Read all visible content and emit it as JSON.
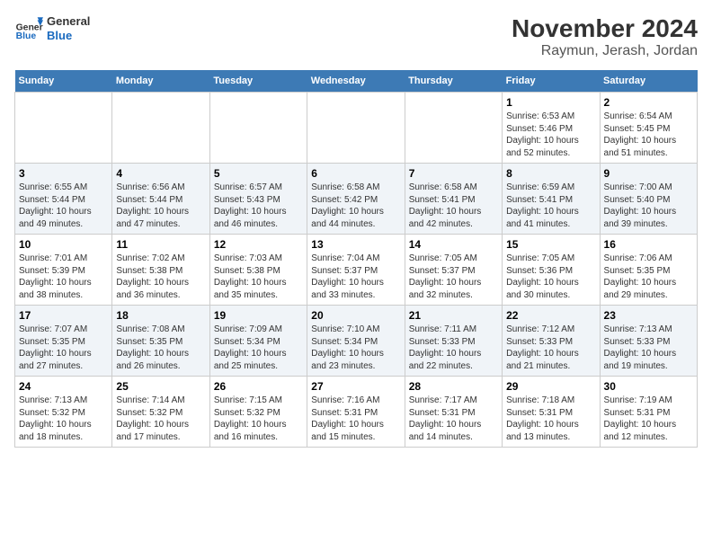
{
  "header": {
    "logo": {
      "general": "General",
      "blue": "Blue"
    },
    "title": "November 2024",
    "subtitle": "Raymun, Jerash, Jordan"
  },
  "days_of_week": [
    "Sunday",
    "Monday",
    "Tuesday",
    "Wednesday",
    "Thursday",
    "Friday",
    "Saturday"
  ],
  "weeks": [
    [
      {
        "day": "",
        "info": ""
      },
      {
        "day": "",
        "info": ""
      },
      {
        "day": "",
        "info": ""
      },
      {
        "day": "",
        "info": ""
      },
      {
        "day": "",
        "info": ""
      },
      {
        "day": "1",
        "info": "Sunrise: 6:53 AM\nSunset: 5:46 PM\nDaylight: 10 hours and 52 minutes."
      },
      {
        "day": "2",
        "info": "Sunrise: 6:54 AM\nSunset: 5:45 PM\nDaylight: 10 hours and 51 minutes."
      }
    ],
    [
      {
        "day": "3",
        "info": "Sunrise: 6:55 AM\nSunset: 5:44 PM\nDaylight: 10 hours and 49 minutes."
      },
      {
        "day": "4",
        "info": "Sunrise: 6:56 AM\nSunset: 5:44 PM\nDaylight: 10 hours and 47 minutes."
      },
      {
        "day": "5",
        "info": "Sunrise: 6:57 AM\nSunset: 5:43 PM\nDaylight: 10 hours and 46 minutes."
      },
      {
        "day": "6",
        "info": "Sunrise: 6:58 AM\nSunset: 5:42 PM\nDaylight: 10 hours and 44 minutes."
      },
      {
        "day": "7",
        "info": "Sunrise: 6:58 AM\nSunset: 5:41 PM\nDaylight: 10 hours and 42 minutes."
      },
      {
        "day": "8",
        "info": "Sunrise: 6:59 AM\nSunset: 5:41 PM\nDaylight: 10 hours and 41 minutes."
      },
      {
        "day": "9",
        "info": "Sunrise: 7:00 AM\nSunset: 5:40 PM\nDaylight: 10 hours and 39 minutes."
      }
    ],
    [
      {
        "day": "10",
        "info": "Sunrise: 7:01 AM\nSunset: 5:39 PM\nDaylight: 10 hours and 38 minutes."
      },
      {
        "day": "11",
        "info": "Sunrise: 7:02 AM\nSunset: 5:38 PM\nDaylight: 10 hours and 36 minutes."
      },
      {
        "day": "12",
        "info": "Sunrise: 7:03 AM\nSunset: 5:38 PM\nDaylight: 10 hours and 35 minutes."
      },
      {
        "day": "13",
        "info": "Sunrise: 7:04 AM\nSunset: 5:37 PM\nDaylight: 10 hours and 33 minutes."
      },
      {
        "day": "14",
        "info": "Sunrise: 7:05 AM\nSunset: 5:37 PM\nDaylight: 10 hours and 32 minutes."
      },
      {
        "day": "15",
        "info": "Sunrise: 7:05 AM\nSunset: 5:36 PM\nDaylight: 10 hours and 30 minutes."
      },
      {
        "day": "16",
        "info": "Sunrise: 7:06 AM\nSunset: 5:35 PM\nDaylight: 10 hours and 29 minutes."
      }
    ],
    [
      {
        "day": "17",
        "info": "Sunrise: 7:07 AM\nSunset: 5:35 PM\nDaylight: 10 hours and 27 minutes."
      },
      {
        "day": "18",
        "info": "Sunrise: 7:08 AM\nSunset: 5:35 PM\nDaylight: 10 hours and 26 minutes."
      },
      {
        "day": "19",
        "info": "Sunrise: 7:09 AM\nSunset: 5:34 PM\nDaylight: 10 hours and 25 minutes."
      },
      {
        "day": "20",
        "info": "Sunrise: 7:10 AM\nSunset: 5:34 PM\nDaylight: 10 hours and 23 minutes."
      },
      {
        "day": "21",
        "info": "Sunrise: 7:11 AM\nSunset: 5:33 PM\nDaylight: 10 hours and 22 minutes."
      },
      {
        "day": "22",
        "info": "Sunrise: 7:12 AM\nSunset: 5:33 PM\nDaylight: 10 hours and 21 minutes."
      },
      {
        "day": "23",
        "info": "Sunrise: 7:13 AM\nSunset: 5:33 PM\nDaylight: 10 hours and 19 minutes."
      }
    ],
    [
      {
        "day": "24",
        "info": "Sunrise: 7:13 AM\nSunset: 5:32 PM\nDaylight: 10 hours and 18 minutes."
      },
      {
        "day": "25",
        "info": "Sunrise: 7:14 AM\nSunset: 5:32 PM\nDaylight: 10 hours and 17 minutes."
      },
      {
        "day": "26",
        "info": "Sunrise: 7:15 AM\nSunset: 5:32 PM\nDaylight: 10 hours and 16 minutes."
      },
      {
        "day": "27",
        "info": "Sunrise: 7:16 AM\nSunset: 5:31 PM\nDaylight: 10 hours and 15 minutes."
      },
      {
        "day": "28",
        "info": "Sunrise: 7:17 AM\nSunset: 5:31 PM\nDaylight: 10 hours and 14 minutes."
      },
      {
        "day": "29",
        "info": "Sunrise: 7:18 AM\nSunset: 5:31 PM\nDaylight: 10 hours and 13 minutes."
      },
      {
        "day": "30",
        "info": "Sunrise: 7:19 AM\nSunset: 5:31 PM\nDaylight: 10 hours and 12 minutes."
      }
    ]
  ]
}
